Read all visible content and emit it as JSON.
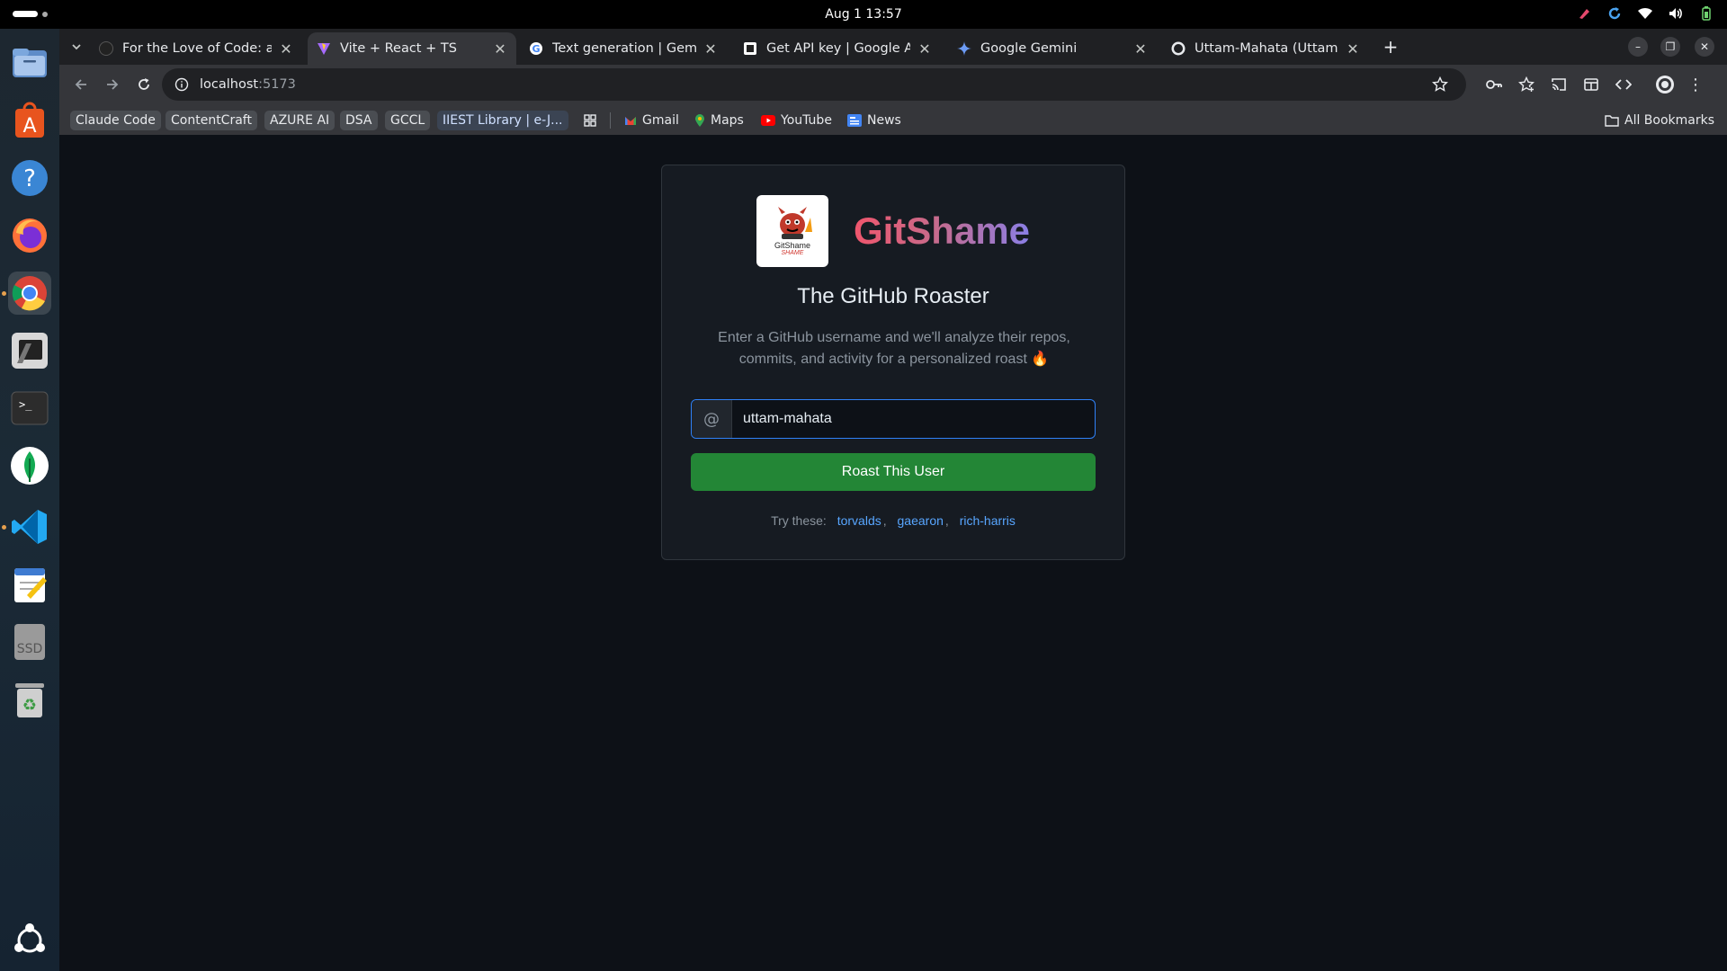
{
  "system": {
    "clock": "Aug 1  13:57"
  },
  "tabs": [
    {
      "title": "For the Love of Code: a s",
      "favicon": "github-icon"
    },
    {
      "title": "Vite + React + TS",
      "favicon": "vite-icon",
      "active": true
    },
    {
      "title": "Text generation  |  Gemin",
      "favicon": "google-icon"
    },
    {
      "title": "Get API key | Google AI S",
      "favicon": "api-key-icon"
    },
    {
      "title": "Google Gemini",
      "favicon": "gemini-icon"
    },
    {
      "title": "Uttam-Mahata (Uttam M",
      "favicon": "github-icon"
    }
  ],
  "address": {
    "host": "localhost",
    "port": ":5173"
  },
  "bookmarks": {
    "chips": [
      "Claude Code",
      "ContentCraft",
      "AZURE AI",
      "DSA",
      "GCCL",
      "IIEST Library | e-J..."
    ],
    "links": [
      "Gmail",
      "Maps",
      "YouTube",
      "News"
    ],
    "all": "All Bookmarks"
  },
  "app": {
    "brand": "GitShame",
    "logo_text": "GitShame",
    "logo_subtext": "SHAME",
    "subtitle": "The GitHub Roaster",
    "description": "Enter a GitHub username and we'll analyze their repos, commits, and activity for a personalized roast 🔥",
    "input_prefix": "@",
    "username_value": "uttam-mahata",
    "button_label": "Roast This User",
    "try_label": "Try these:",
    "suggestions": [
      "torvalds",
      "gaearon",
      "rich-harris"
    ]
  },
  "colors": {
    "accent_blue": "#2f81f7",
    "button_green": "#238636",
    "link": "#58a6ff",
    "page_bg": "#0d1117"
  }
}
